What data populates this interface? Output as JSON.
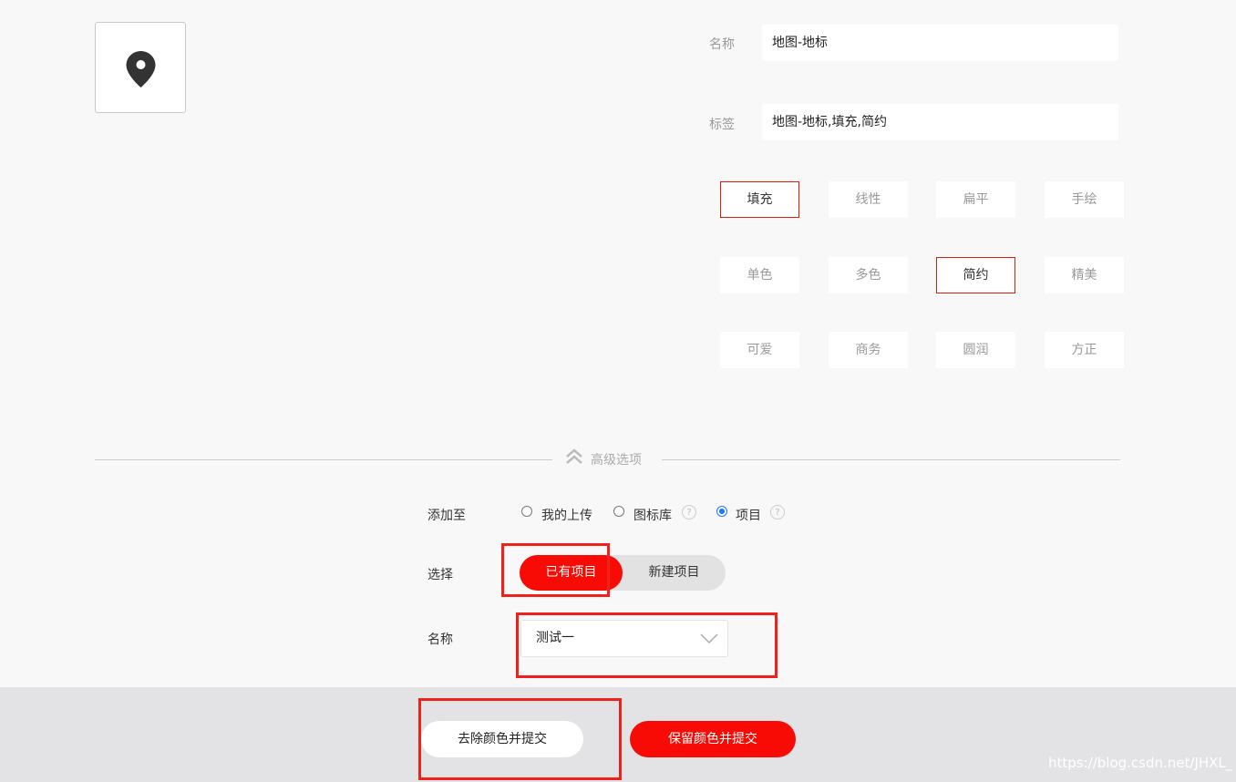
{
  "preview": {
    "icon": "map-pin-icon"
  },
  "form": {
    "name_label": "名称",
    "name_value": "地图-地标",
    "tags_label": "标签",
    "tags_value": "地图-地标,填充,简约"
  },
  "style_tags": [
    {
      "label": "填充",
      "active": true
    },
    {
      "label": "线性",
      "active": false
    },
    {
      "label": "扁平",
      "active": false
    },
    {
      "label": "手绘",
      "active": false
    },
    {
      "label": "单色",
      "active": false
    },
    {
      "label": "多色",
      "active": false
    },
    {
      "label": "简约",
      "active": true
    },
    {
      "label": "精美",
      "active": false
    },
    {
      "label": "可爱",
      "active": false
    },
    {
      "label": "商务",
      "active": false
    },
    {
      "label": "圆润",
      "active": false
    },
    {
      "label": "方正",
      "active": false
    }
  ],
  "advanced": {
    "label": "高级选项",
    "icon": "double-chevron-up-icon"
  },
  "add_to": {
    "label": "添加至",
    "options": [
      {
        "label": "我的上传",
        "checked": false
      },
      {
        "label": "图标库",
        "checked": false,
        "help": "?"
      },
      {
        "label": "项目",
        "checked": true,
        "help": "?"
      }
    ]
  },
  "select_row": {
    "label": "选择",
    "options": [
      "已有项目",
      "新建项目"
    ],
    "selected": "已有项目"
  },
  "project_name": {
    "label": "名称",
    "value": "测试一"
  },
  "footer": {
    "remove_color_submit": "去除颜色并提交",
    "keep_color_submit": "保留颜色并提交"
  },
  "watermark": "https://blog.csdn.net/JHXL_",
  "colors": {
    "accent_red": "#f80b05",
    "radio_blue": "#1677ff",
    "highlight": "#f0201a"
  }
}
